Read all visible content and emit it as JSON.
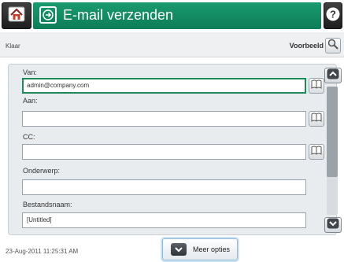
{
  "header": {
    "title": "E-mail verzenden",
    "home_icon": "home-icon",
    "app_icon": "email-send-icon",
    "help_icon": "help-icon"
  },
  "status": {
    "text": "Klaar",
    "preview_label": "Voorbeeld",
    "preview_icon": "magnifier-icon"
  },
  "form": {
    "from": {
      "label": "Van:",
      "value": "admin@company.com"
    },
    "to": {
      "label": "Aan:",
      "value": ""
    },
    "cc": {
      "label": "CC:",
      "value": ""
    },
    "subject": {
      "label": "Onderwerp:",
      "value": ""
    },
    "filename": {
      "label": "Bestandsnaam:",
      "value": "[Untitled]"
    }
  },
  "footer": {
    "timestamp": "23-Aug-2011 11:25:31 AM",
    "more_options_label": "Meer opties"
  },
  "colors": {
    "title_bar": "#118a62",
    "active_field_border": "#1d8a5a",
    "panel_bg": "#e9ecef"
  }
}
